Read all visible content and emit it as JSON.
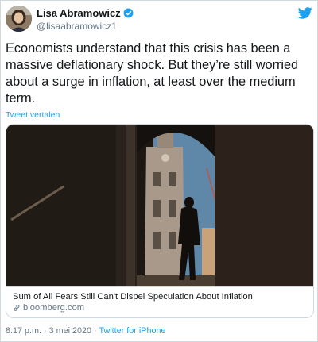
{
  "author": {
    "display_name": "Lisa Abramowicz",
    "handle": "@lisaabramowicz1",
    "verified": true
  },
  "tweet": {
    "text": "Economists understand that this crisis has been a massive deflationary shock. But they’re still worried about a surge in inflation, at least over the medium term.",
    "translate_label": "Tweet vertalen"
  },
  "card": {
    "title": "Sum of All Fears Still Can't Dispel Speculation About Inflation",
    "domain": "bloomberg.com"
  },
  "meta": {
    "time": "8:17 p.m.",
    "separator": "·",
    "date": "3 mei 2020",
    "source": "Twitter for iPhone"
  },
  "icons": {
    "verified": "verified-badge-icon",
    "brand": "twitter-bird-icon",
    "link": "link-icon"
  },
  "colors": {
    "accent": "#1da1f2",
    "text": "#14171a",
    "secondary": "#657786",
    "border": "#cfd9de"
  }
}
